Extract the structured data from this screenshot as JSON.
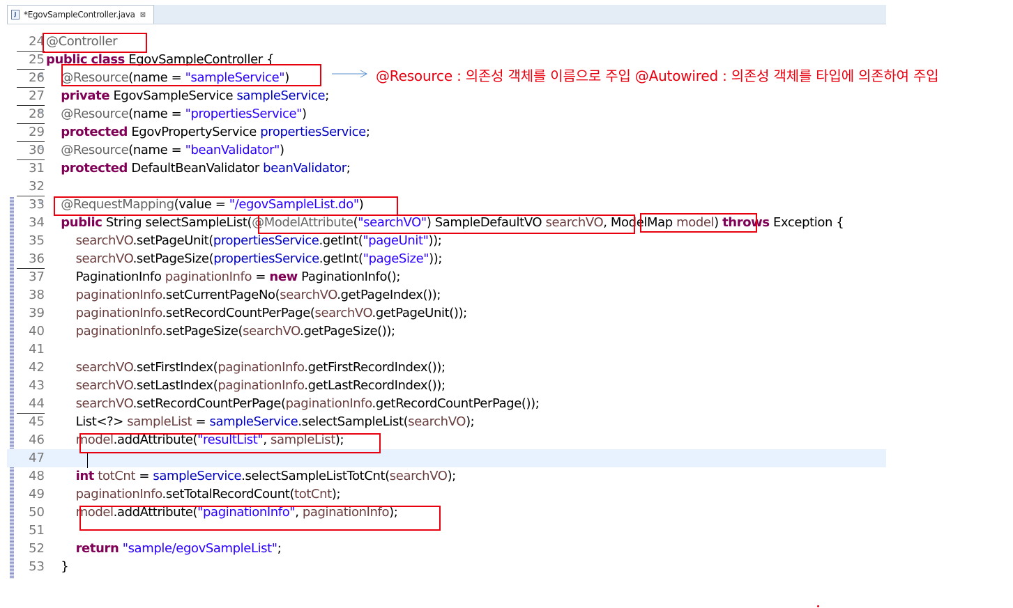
{
  "tab": {
    "title": "*EgovSampleController.java",
    "close_glyph": "⊠",
    "icon": "java-file-icon",
    "icon_glyph": "J"
  },
  "annotation": {
    "text": "@Resource : 의존성 객체를 이름으로 주입 @Autowired : 의존성 객체를 타입에 의존하여 주입",
    "color": "#e8000f"
  },
  "lines": [
    {
      "num": "24",
      "code": "@Controller"
    },
    {
      "num": "25",
      "code": "public class EgovSampleController {"
    },
    {
      "num": "26",
      "code": "@Resource(name = \"sampleService\")"
    },
    {
      "num": "27",
      "code": "private EgovSampleService sampleService;"
    },
    {
      "num": "28",
      "code": "@Resource(name = \"propertiesService\")"
    },
    {
      "num": "29",
      "code": "protected EgovPropertyService propertiesService;"
    },
    {
      "num": "30",
      "code": "@Resource(name = \"beanValidator\")"
    },
    {
      "num": "31",
      "code": "protected DefaultBeanValidator beanValidator;"
    },
    {
      "num": "32",
      "code": ""
    },
    {
      "num": "33",
      "code": "@RequestMapping(value = \"/egovSampleList.do\")"
    },
    {
      "num": "34",
      "code": "public String selectSampleList(@ModelAttribute(\"searchVO\") SampleDefaultVO searchVO, ModelMap model) throws Exception {"
    },
    {
      "num": "35",
      "code": "searchVO.setPageUnit(propertiesService.getInt(\"pageUnit\"));"
    },
    {
      "num": "36",
      "code": "searchVO.setPageSize(propertiesService.getInt(\"pageSize\"));"
    },
    {
      "num": "37",
      "code": "PaginationInfo paginationInfo = new PaginationInfo();"
    },
    {
      "num": "38",
      "code": "paginationInfo.setCurrentPageNo(searchVO.getPageIndex());"
    },
    {
      "num": "39",
      "code": "paginationInfo.setRecordCountPerPage(searchVO.getPageUnit());"
    },
    {
      "num": "40",
      "code": "paginationInfo.setPageSize(searchVO.getPageSize());"
    },
    {
      "num": "41",
      "code": ""
    },
    {
      "num": "42",
      "code": "searchVO.setFirstIndex(paginationInfo.getFirstRecordIndex());"
    },
    {
      "num": "43",
      "code": "searchVO.setLastIndex(paginationInfo.getLastRecordIndex());"
    },
    {
      "num": "44",
      "code": "searchVO.setRecordCountPerPage(paginationInfo.getRecordCountPerPage());"
    },
    {
      "num": "45",
      "code": "List<?> sampleList = sampleService.selectSampleList(searchVO);"
    },
    {
      "num": "46",
      "code": "model.addAttribute(\"resultList\", sampleList);"
    },
    {
      "num": "47",
      "code": ""
    },
    {
      "num": "48",
      "code": "int totCnt = sampleService.selectSampleListTotCnt(searchVO);"
    },
    {
      "num": "49",
      "code": "paginationInfo.setTotalRecordCount(totCnt);"
    },
    {
      "num": "50",
      "code": "model.addAttribute(\"paginationInfo\", paginationInfo);"
    },
    {
      "num": "51",
      "code": ""
    },
    {
      "num": "52",
      "code": "return \"sample/egovSampleList\";"
    },
    {
      "num": "53",
      "code": "}"
    }
  ]
}
